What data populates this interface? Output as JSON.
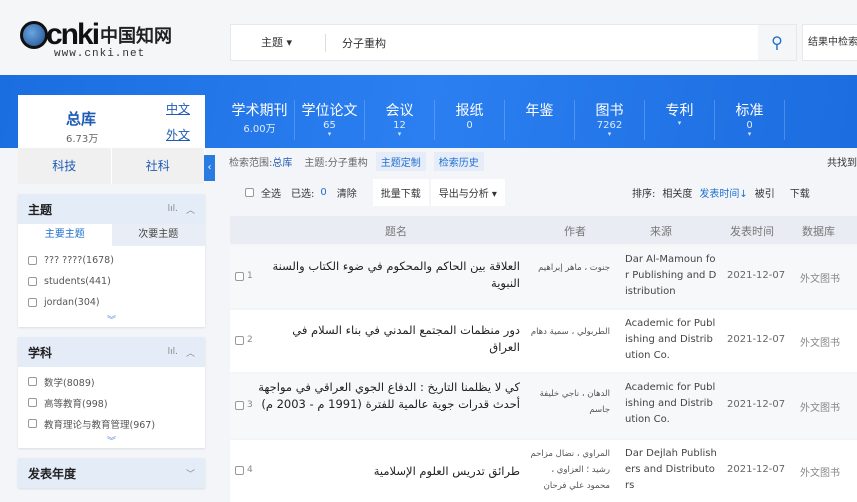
{
  "header": {
    "logo_text": "cnki",
    "logo_cn": "中国知网",
    "logo_url": "www.cnki.net",
    "search_field": "主题",
    "search_value": "分子重构",
    "search_in_results": "结果中检索"
  },
  "zongku": {
    "label": "总库",
    "count": "6.73万",
    "zh": "中文",
    "wai": "外文"
  },
  "databases": [
    {
      "name": "学术期刊",
      "count": "6.00万",
      "arrow": ""
    },
    {
      "name": "学位论文",
      "count": "65",
      "arrow": "▾"
    },
    {
      "name": "会议",
      "count": "12",
      "arrow": "▾"
    },
    {
      "name": "报纸",
      "count": "0",
      "arrow": ""
    },
    {
      "name": "年鉴",
      "count": "",
      "arrow": ""
    },
    {
      "name": "图书",
      "count": "7262",
      "arrow": "▾"
    },
    {
      "name": "专利",
      "count": "",
      "arrow": "▾"
    },
    {
      "name": "标准",
      "count": "0",
      "arrow": "▾"
    }
  ],
  "sidebar": {
    "subtabs": [
      "科技",
      "社科"
    ],
    "topic": {
      "title": "主题",
      "tab_main": "主要主题",
      "tab_sub": "次要主题",
      "items": [
        "??? ????(1678)",
        "students(441)",
        "jordan(304)"
      ]
    },
    "subject": {
      "title": "学科",
      "items": [
        "数学(8089)",
        "高等教育(998)",
        "教育理论与教育管理(967)"
      ]
    },
    "year": {
      "title": "发表年度"
    }
  },
  "crumb": {
    "scope_label": "检索范围:",
    "scope": "总库",
    "topic_label": "主题:",
    "topic": "分子重构",
    "custom": "主题定制",
    "history": "检索历史",
    "found": "共找到"
  },
  "toolbar": {
    "select_all": "全选",
    "selected": "已选:",
    "selected_count": "0",
    "clear": "清除",
    "batch": "批量下载",
    "export": "导出与分析 ▾",
    "sort_label": "排序:",
    "sort_relevance": "相关度",
    "sort_date": "发表时间↓",
    "sort_cite": "被引",
    "sort_download": "下载"
  },
  "table": {
    "headers": [
      "题名",
      "作者",
      "来源",
      "发表时间",
      "数据库"
    ],
    "rows": [
      {
        "num": "1",
        "title": "العلاقة بين الحاكم والمحكوم في ضوء الكتاب والسنة النبوية",
        "author": "جنوت ، ماهر إبراهيم",
        "source": "Dar Al-Mamoun for Publishing and Distribution",
        "date": "2021-12-07",
        "db": "外文图书"
      },
      {
        "num": "2",
        "title": "دور منظمات المجتمع المدني في بناء السلام في العراق",
        "author": "الطربولي ، سمية دهام",
        "source": "Academic for Publishing and Distribution Co.",
        "date": "2021-12-07",
        "db": "外文图书"
      },
      {
        "num": "3",
        "title": "كي لا يظلمنا التاريخ : الدفاع الجوي العراقي في مواجهة أحدث قدرات جوية عالمية للفترة (1991 م - 2003 م)",
        "author": "الدهان ، ناجي خليفة جاسم",
        "source": "Academic for Publishing and Distribution Co.",
        "date": "2021-12-07",
        "db": "外文图书"
      },
      {
        "num": "4",
        "title": "طرائق تدريس العلوم الإسلامية",
        "author": "المراوي ، نضال مزاحم رشيد ؛ العزاوي ، محمود علي فرحان",
        "source": "Dar Dejlah Publishers and Distributors",
        "date": "2021-12-07",
        "db": "外文图书"
      }
    ]
  }
}
